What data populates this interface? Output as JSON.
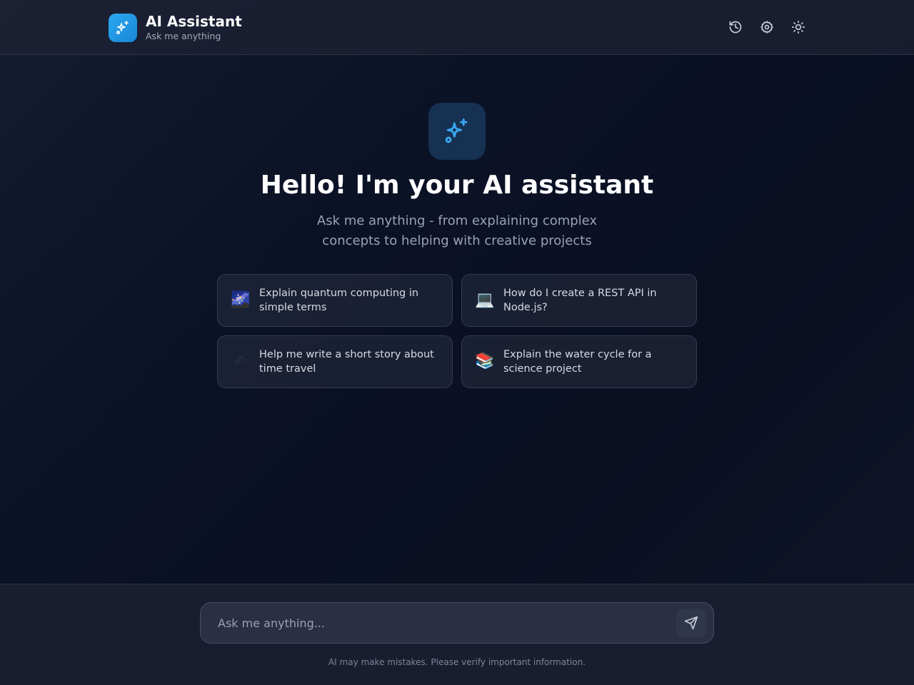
{
  "header": {
    "title": "AI Assistant",
    "subtitle": "Ask me anything",
    "logo_icon": "sparkles-icon",
    "actions": [
      {
        "name": "history-icon"
      },
      {
        "name": "gear-icon"
      },
      {
        "name": "sun-icon"
      }
    ]
  },
  "hero": {
    "icon": "sparkles-icon",
    "title": "Hello! I'm your AI assistant",
    "subtitle": "Ask me anything - from explaining complex concepts to helping with creative projects"
  },
  "suggestions": [
    {
      "emoji": "🌌",
      "text": "Explain quantum computing in simple terms"
    },
    {
      "emoji": "💻",
      "text": "How do I create a REST API in Node.js?"
    },
    {
      "emoji": "✍",
      "text": "Help me write a short story about time travel"
    },
    {
      "emoji": "📚",
      "text": "Explain the water cycle for a science project"
    }
  ],
  "composer": {
    "placeholder": "Ask me anything...",
    "value": "",
    "send_icon": "send-icon"
  },
  "footer": {
    "disclaimer": "AI may make mistakes. Please verify important information."
  },
  "colors": {
    "accent": "#2ba8f0",
    "background": "#0c1226",
    "card_border": "#343a52"
  }
}
